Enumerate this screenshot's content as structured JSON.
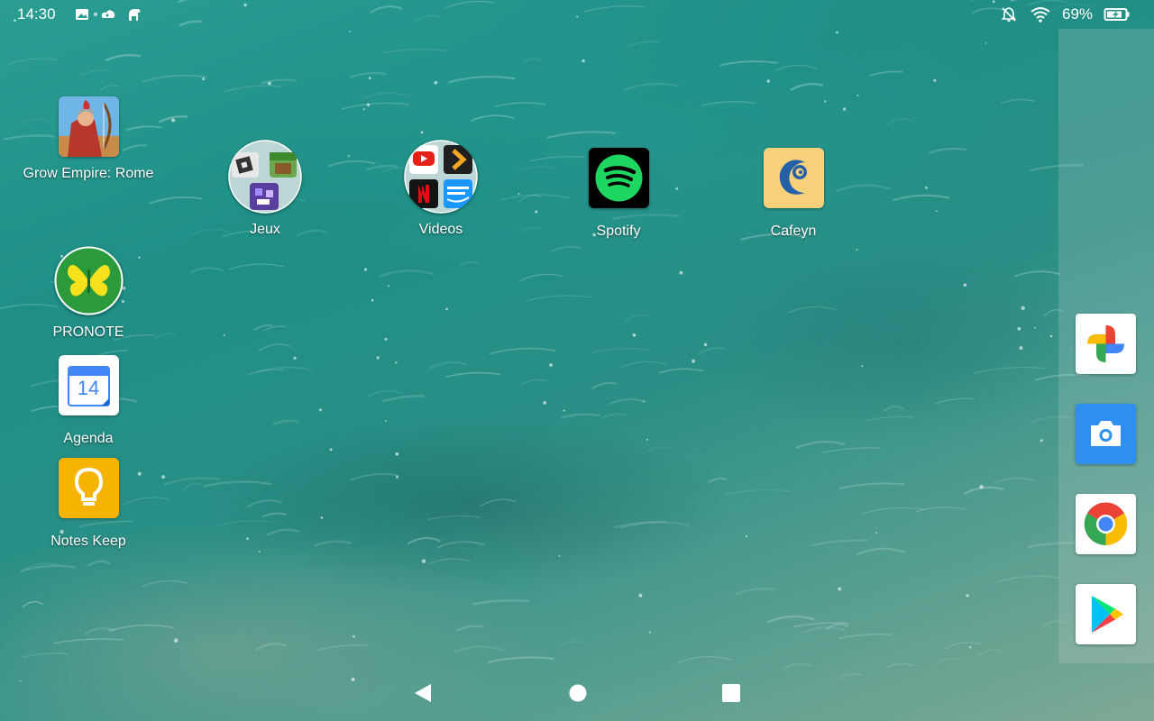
{
  "status_bar": {
    "time": "14:30",
    "notification_icons": [
      "gallery-icon",
      "cloud-game-icon",
      "pony-icon"
    ],
    "system_icons": [
      "notifications-off-icon",
      "wifi-icon",
      "battery-charging-icon"
    ],
    "battery_percent": "69%"
  },
  "desktop": {
    "apps": [
      {
        "label": "Grow Empire: Rome",
        "icon": "grow-empire-rome-icon"
      },
      {
        "label": "Jeux",
        "icon": "folder-icon"
      },
      {
        "label": "Videos",
        "icon": "folder-icon"
      },
      {
        "label": "Spotify",
        "icon": "spotify-icon"
      },
      {
        "label": "Cafeyn",
        "icon": "cafeyn-icon"
      },
      {
        "label": "PRONOTE",
        "icon": "pronote-icon"
      },
      {
        "label": "Agenda",
        "icon": "calendar-icon",
        "icon_text": "14"
      },
      {
        "label": "Notes Keep",
        "icon": "keep-bulb-icon"
      }
    ]
  },
  "dock": {
    "apps": [
      {
        "name": "Google Photos",
        "icon": "photos-pinwheel-icon"
      },
      {
        "name": "Camera",
        "icon": "camera-icon"
      },
      {
        "name": "Chrome",
        "icon": "chrome-icon"
      },
      {
        "name": "Play Store",
        "icon": "play-store-icon"
      }
    ]
  },
  "navigation_bar": {
    "buttons": [
      "back-icon",
      "home-icon",
      "recents-icon"
    ]
  },
  "colors": {
    "spotify_green": "#1ed760",
    "pronote_green": "#2a9a3a",
    "keep_yellow": "#f6b400",
    "calendar_blue": "#4285f4",
    "camera_blue": "#2f8ff0",
    "cafeyn_bg": "#f7d17a"
  }
}
